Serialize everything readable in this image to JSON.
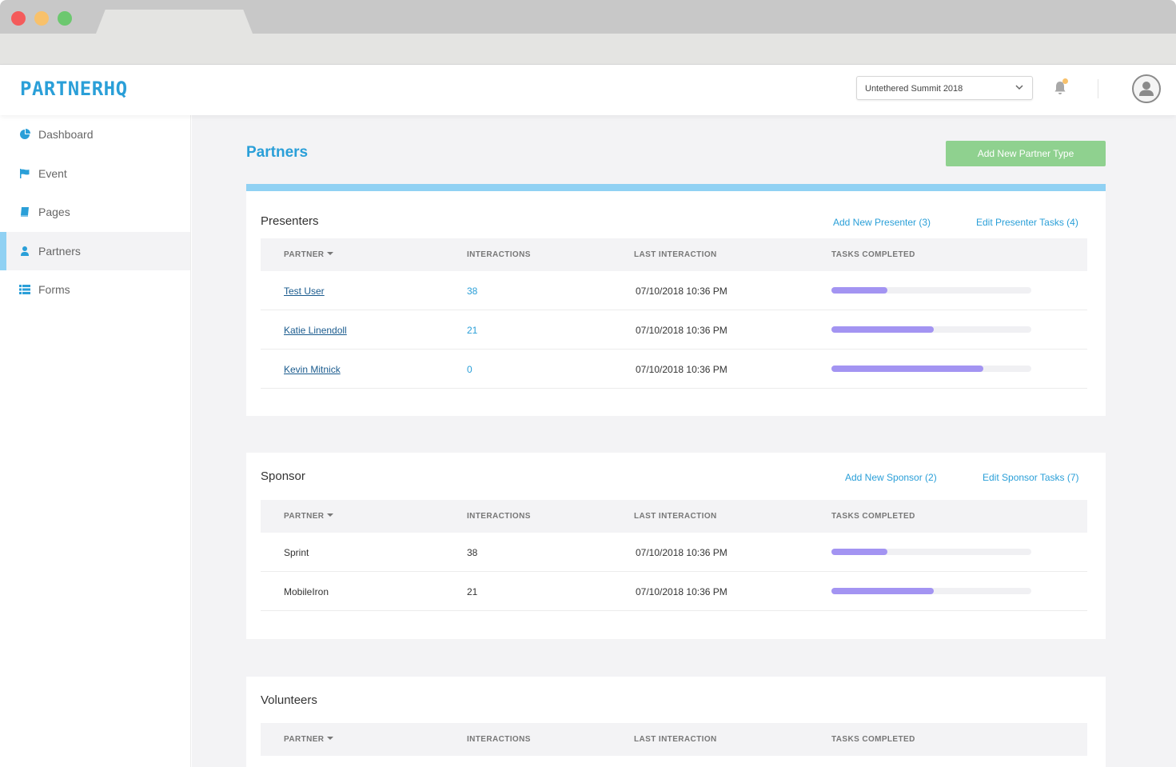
{
  "app": {
    "logo": "PARTNERHQ"
  },
  "header": {
    "event_selected": "Untethered Summit 2018"
  },
  "sidebar": {
    "items": [
      {
        "label": "Dashboard",
        "icon": "pie-chart-icon"
      },
      {
        "label": "Event",
        "icon": "flag-icon"
      },
      {
        "label": "Pages",
        "icon": "book-icon"
      },
      {
        "label": "Partners",
        "icon": "user-icon",
        "active": true
      },
      {
        "label": "Forms",
        "icon": "list-icon"
      }
    ]
  },
  "main": {
    "title": "Partners",
    "add_type_label": "Add New Partner Type",
    "columns": {
      "partner": "PARTNER",
      "interactions": "INTERACTIONS",
      "last_interaction": "LAST INTERACTION",
      "tasks_completed": "TASKS COMPLETED"
    },
    "sections": [
      {
        "title": "Presenters",
        "add_link": "Add New Presenter (3)",
        "edit_link": "Edit Presenter Tasks (4)",
        "rows": [
          {
            "partner": "Test User",
            "interactions": "38",
            "last": "07/10/2018 10:36 PM",
            "progress": 0.28
          },
          {
            "partner": "Katie Linendoll ",
            "interactions": "21",
            "last": "07/10/2018 10:36 PM",
            "progress": 0.51
          },
          {
            "partner": "Kevin Mitnick ",
            "interactions": "0",
            "last": "07/10/2018 10:36 PM",
            "progress": 0.76
          }
        ]
      },
      {
        "title": "Sponsor",
        "add_link": "Add New Sponsor (2)",
        "edit_link": "Edit Sponsor Tasks (7)",
        "rows": [
          {
            "partner": "Sprint",
            "interactions": "38",
            "last": "07/10/2018 10:36 PM",
            "progress": 0.28
          },
          {
            "partner": "MobileIron",
            "interactions": "21",
            "last": "07/10/2018 10:36 PM",
            "progress": 0.51
          }
        ]
      },
      {
        "title": "Volunteers",
        "rows": []
      }
    ]
  },
  "colors": {
    "accent_blue": "#2a9fd8",
    "button_green": "#8fd18f",
    "progress_purple": "#a394f2",
    "card_accent": "#90d1f3"
  }
}
